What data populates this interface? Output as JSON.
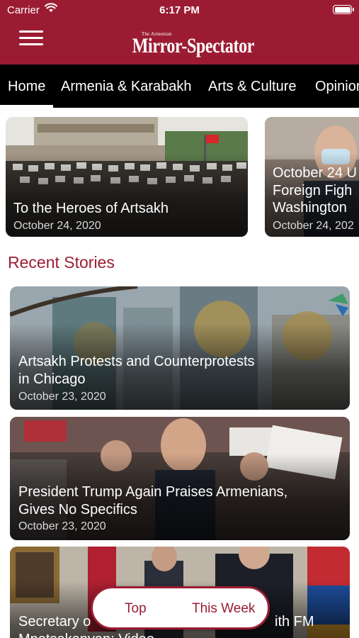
{
  "status_bar": {
    "carrier": "Carrier",
    "time": "6:17 PM"
  },
  "header": {
    "logo_kicker": "The Armenian",
    "logo_name": "Mirror-Spectator",
    "accent_color": "#9b1c32"
  },
  "tabs": [
    {
      "label": "Home",
      "selected": true
    },
    {
      "label": "Armenia & Karabakh",
      "selected": false
    },
    {
      "label": "Arts & Culture",
      "selected": false
    },
    {
      "label": "Opinion",
      "selected": false
    }
  ],
  "featured": [
    {
      "title": "To the Heroes of Artsakh",
      "date": "October 24, 2020"
    },
    {
      "title_lines": [
        "October 24 U",
        "Foreign Figh",
        "Washington"
      ],
      "date": "October 24, 202"
    }
  ],
  "recent_heading": "Recent Stories",
  "stories": [
    {
      "title_lines": [
        "Artsakh Protests and Counterprotests",
        "in Chicago"
      ],
      "date": "October 23, 2020"
    },
    {
      "title_lines": [
        "President Trump Again Praises Armenians,",
        "Gives No Specifics"
      ],
      "date": "October 23, 2020"
    },
    {
      "title_lines": [
        "Secretary o",
        "Mnatsakanyan: Video"
      ],
      "title_tail": "ith FM"
    }
  ],
  "sort_pill": {
    "top_label": "Top",
    "week_label": "This Week"
  }
}
